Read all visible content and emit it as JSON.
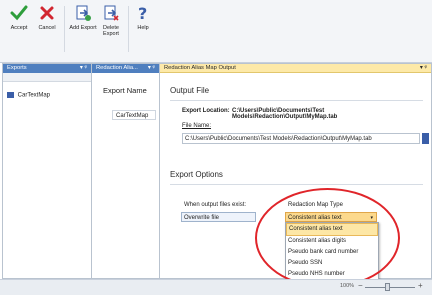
{
  "ribbon": {
    "buttons": [
      {
        "label": "Accept",
        "icon": "accept-check-icon"
      },
      {
        "label": "Cancel",
        "icon": "cancel-x-icon"
      },
      {
        "label": "Add Export",
        "icon": "add-export-icon"
      },
      {
        "label": "Delete Export",
        "icon": "delete-export-icon"
      },
      {
        "label": "Help",
        "icon": "help-question-icon"
      }
    ]
  },
  "panels": {
    "exports": {
      "title": "Exports",
      "item": "CarTextMap"
    },
    "alias": {
      "title": "Redaction Alia...",
      "column": "Export Name",
      "cell": "CarTextMap"
    },
    "output": {
      "title": "Redaction Alias Map Output"
    }
  },
  "output_file": {
    "section": "Output File",
    "location_label": "Export Location:",
    "location_value": "C:\\Users\\Public\\Documents\\Test Models\\Redaction\\Output\\MyMap.tab",
    "filename_label": "File Name:",
    "filename_value": "C:\\Users\\Public\\Documents\\Test Models\\Redaction\\Output\\MyMap.tab"
  },
  "export_options": {
    "section": "Export Options",
    "when_exists_label": "When output files exist:",
    "when_exists_value": "Overwrite file",
    "map_type_label": "Redaction Map Type",
    "map_type_value": "Consistent alias text",
    "map_type_options": [
      "Consistent alias text",
      "Consistent alias digits",
      "Pseudo bank card number",
      "Pseudo SSN",
      "Pseudo NHS number"
    ]
  },
  "status": {
    "zoom_label": "100%"
  },
  "colors": {
    "annotation": "#e0252a",
    "selection": "#fde7a6",
    "header_blue": "#4f7fbf"
  }
}
